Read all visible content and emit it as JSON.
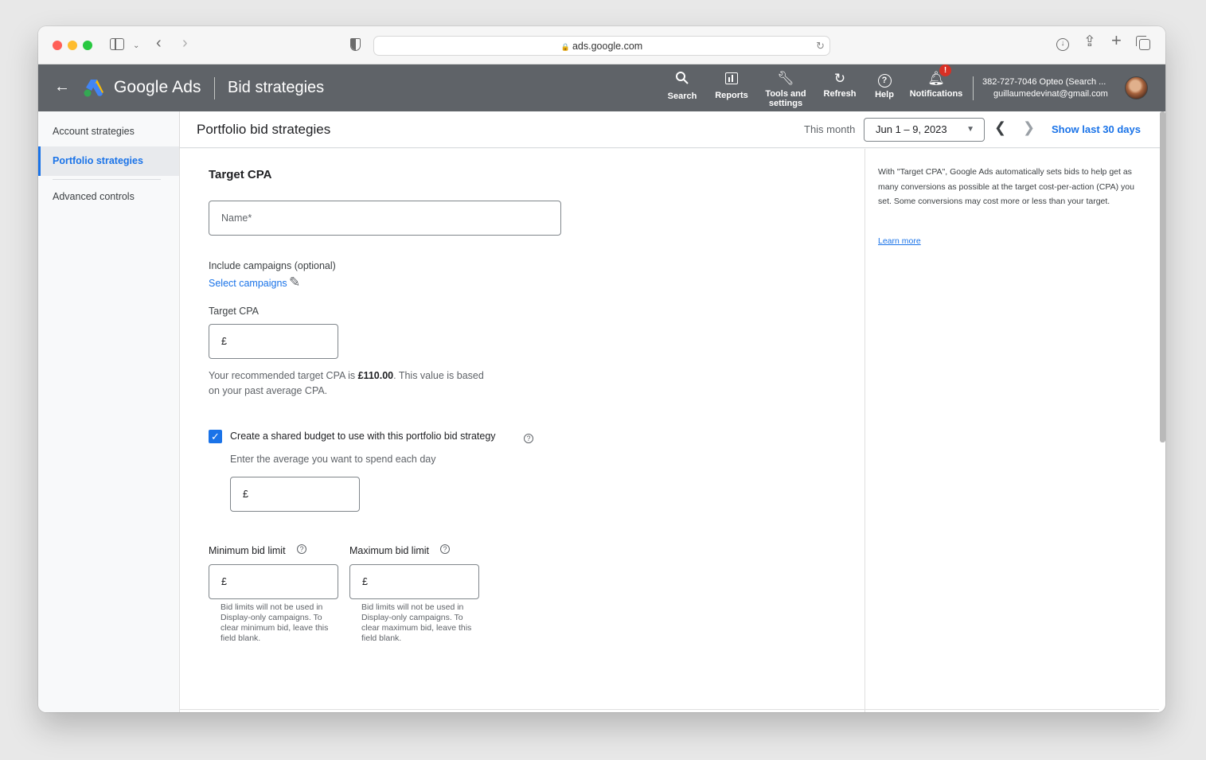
{
  "browser": {
    "url": "ads.google.com"
  },
  "header": {
    "logo_text": "Google Ads",
    "page_title": "Bid strategies",
    "tools": [
      {
        "label": "Search",
        "icon": "search-icon"
      },
      {
        "label": "Reports",
        "icon": "reports-icon"
      },
      {
        "label": "Tools and settings",
        "icon": "wrench-icon"
      },
      {
        "label": "Refresh",
        "icon": "refresh-icon"
      },
      {
        "label": "Help",
        "icon": "help-icon"
      },
      {
        "label": "Notifications",
        "icon": "bell-icon"
      }
    ],
    "notification_badge": "!",
    "account_id": "382-727-7046 Opteo (Search ...",
    "account_email": "guillaumedevinat@gmail.com"
  },
  "sidebar": {
    "items": [
      {
        "label": "Account strategies"
      },
      {
        "label": "Portfolio strategies",
        "active": true
      },
      {
        "label": "Advanced controls"
      }
    ]
  },
  "page_header": {
    "title": "Portfolio bid strategies",
    "date_label": "This month",
    "date_range": "Jun 1 – 9, 2023",
    "show_last": "Show last 30 days"
  },
  "form": {
    "section_title": "Target CPA",
    "name_placeholder": "Name*",
    "include_label": "Include campaigns (optional)",
    "select_campaigns": "Select campaigns",
    "target_cpa_label": "Target CPA",
    "currency": "£",
    "recommendation_prefix": "Your recommended target CPA is ",
    "recommendation_value": "£110.00",
    "recommendation_suffix": ". This value is based",
    "recommendation_line2": "on your past average CPA.",
    "shared_budget_label": "Create a shared budget to use with this portfolio bid strategy",
    "shared_budget_checked": true,
    "budget_hint": "Enter the average you want to spend each day",
    "min_bid_label": "Minimum bid limit",
    "max_bid_label": "Maximum bid limit",
    "min_bid_hint": "Bid limits will not be used in Display-only campaigns. To clear minimum bid, leave this field blank.",
    "max_bid_hint": "Bid limits will not be used in Display-only campaigns. To clear maximum bid, leave this field blank."
  },
  "help_panel": {
    "text": "With \"Target CPA\", Google Ads automatically sets bids to help get as many conversions as possible at the target cost-per-action (CPA) you set. Some conversions may cost more or less than your target.",
    "learn_more": "Learn more"
  },
  "colors": {
    "header_bg": "#5f6368",
    "accent": "#1a73e8",
    "notification_badge": "#d93025"
  }
}
